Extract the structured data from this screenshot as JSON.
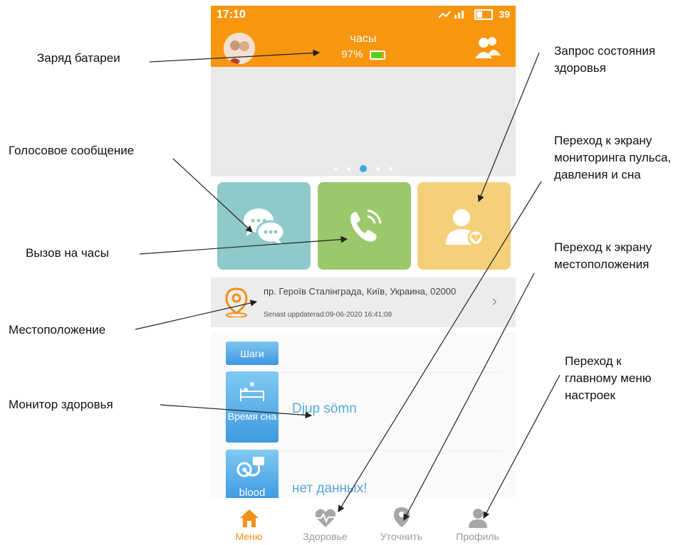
{
  "status": {
    "time": "17:10",
    "signal": "4G",
    "battery_level": "39"
  },
  "header": {
    "title": "часы",
    "battery_text": "97%",
    "battery_fraction": 0.97
  },
  "carousel": {
    "page_count": 5,
    "active_index": 2
  },
  "tiles": {
    "voice_icon": "chat-bubbles-icon",
    "call_icon": "phone-call-icon",
    "health_icon": "person-heart-icon"
  },
  "location": {
    "address": "пр. Героїв Сталінграда, Київ, Украина, 02000",
    "updated": "Senast uppdaterad:09-06-2020 16:41:08"
  },
  "health": {
    "steps_label": "Шаги",
    "sleep_label": "Время сна",
    "sleep_value": "Djup sömn",
    "blood_label": "blood",
    "blood_value": "нет данных!"
  },
  "nav": [
    {
      "label": "Меню",
      "icon": "home-icon",
      "active": true
    },
    {
      "label": "Здоровье",
      "icon": "heartbeat-icon",
      "active": false
    },
    {
      "label": "Уточнить",
      "icon": "location-pin-icon",
      "active": false
    },
    {
      "label": "Профиль",
      "icon": "user-icon",
      "active": false
    }
  ],
  "callouts": {
    "battery": "Заряд батареи",
    "voice": "Голосовое сообщение",
    "call": "Вызов на часы",
    "location": "Местоположение",
    "monitor": "Монитор здоровья",
    "health_request": "Запрос состояния\nздоровья",
    "pulse_screen": "Переход к экрану\nмониторинга пульса,\nдавления и сна",
    "location_screen": "Переход к экрану\nместоположения",
    "settings_menu": "Переход к\nглавному меню\nнастроек"
  },
  "colors": {
    "accent": "#f7960f",
    "active_nav": "#f29019",
    "link_blue": "#58a7df"
  }
}
